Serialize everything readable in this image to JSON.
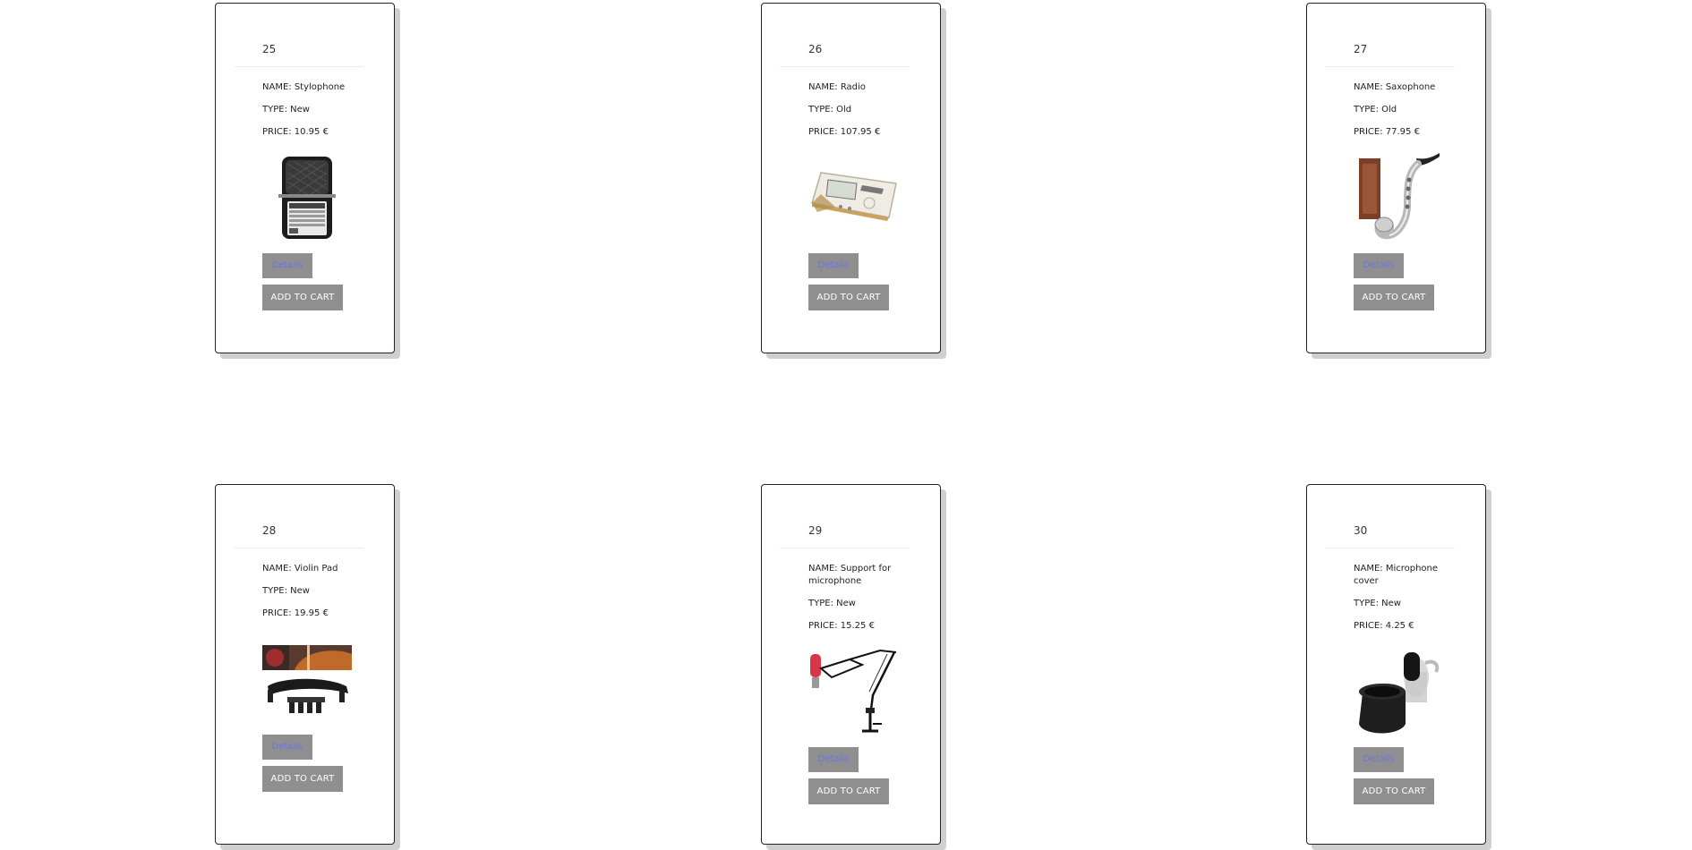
{
  "labels": {
    "name_prefix": "NAME: ",
    "type_prefix": "TYPE: ",
    "price_prefix": "PRICE: ",
    "details_button": "Details",
    "add_to_cart_button": "ADD TO CART"
  },
  "products": [
    {
      "id": "25",
      "name": "NAME: Stylophone",
      "type": "TYPE: New",
      "price": "PRICE: 10.95 €",
      "image_icon": "stylophone-icon"
    },
    {
      "id": "26",
      "name": "NAME: Radio",
      "type": "TYPE: Old",
      "price": "PRICE: 107.95 €",
      "image_icon": "radio-icon"
    },
    {
      "id": "27",
      "name": "NAME: Saxophone",
      "type": "TYPE: Old",
      "price": "PRICE: 77.95 €",
      "image_icon": "saxophone-icon"
    },
    {
      "id": "28",
      "name": "NAME: Violin Pad",
      "type": "TYPE: New",
      "price": "PRICE: 19.95 €",
      "image_icon": "violin-pad-icon"
    },
    {
      "id": "29",
      "name": "NAME: Support for microphone",
      "type": "TYPE: New",
      "price": "PRICE: 15.25 €",
      "image_icon": "microphone-support-icon"
    },
    {
      "id": "30",
      "name": "NAME: Microphone cover",
      "type": "TYPE: New",
      "price": "PRICE: 4.25 €",
      "image_icon": "microphone-cover-icon"
    }
  ],
  "colors": {
    "button_bg": "#8f8f8f",
    "details_text": "#6b74e6",
    "card_border": "#222222",
    "card_shadow": "#cfcfcf"
  }
}
